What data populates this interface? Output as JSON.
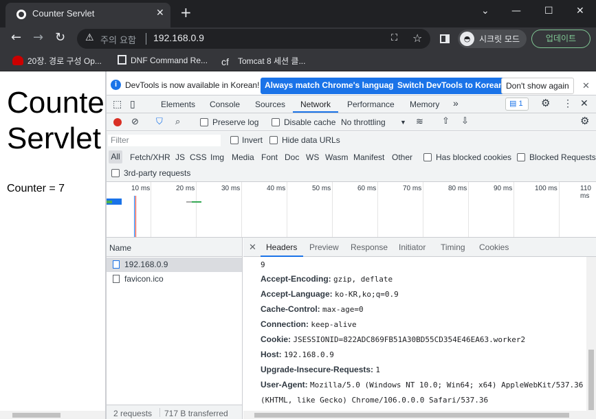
{
  "browser": {
    "tab_title": "Counter Servlet",
    "new_tab_icon": "+",
    "address": {
      "security_label": "주의 요함",
      "url": "192.168.0.9"
    },
    "incognito_label": "시크릿 모드",
    "update_label": "업데이트"
  },
  "bookmarks": [
    {
      "label": "20장. 경로 구성 Op...",
      "icon": "redhat-icon"
    },
    {
      "label": "DNF Command Re...",
      "icon": "book-icon"
    },
    {
      "label": "Tomcat 8 세션 클...",
      "icon": "cf-icon"
    }
  ],
  "page": {
    "heading": "Counter Servlet",
    "counter_text": "Counter = 7"
  },
  "devtools": {
    "infobar": {
      "message": "DevTools is now available in Korean!",
      "btn_match": "Always match Chrome's language",
      "btn_switch": "Switch DevTools to Korean",
      "btn_dismiss": "Don't show again"
    },
    "tabs": [
      "Elements",
      "Console",
      "Sources",
      "Network",
      "Performance",
      "Memory"
    ],
    "active_tab": "Network",
    "more_tabs": "»",
    "issues_count": "1",
    "network_toolbar": {
      "preserve_log": "Preserve log",
      "disable_cache": "Disable cache",
      "throttling": "No throttling"
    },
    "filter": {
      "placeholder": "Filter",
      "invert": "Invert",
      "hide_data_urls": "Hide data URLs"
    },
    "types": [
      "All",
      "Fetch/XHR",
      "JS",
      "CSS",
      "Img",
      "Media",
      "Font",
      "Doc",
      "WS",
      "Wasm",
      "Manifest",
      "Other"
    ],
    "has_blocked_cookies": "Has blocked cookies",
    "blocked_requests": "Blocked Requests",
    "third_party": "3rd-party requests",
    "timeline_ticks": [
      "10 ms",
      "20 ms",
      "30 ms",
      "40 ms",
      "50 ms",
      "60 ms",
      "70 ms",
      "80 ms",
      "90 ms",
      "100 ms",
      "110 ms"
    ],
    "request_list": {
      "header": "Name",
      "rows": [
        "192.168.0.9",
        "favicon.ico"
      ],
      "status": "2 requests",
      "transferred": "717 B transferred"
    },
    "detail": {
      "tabs": [
        "Headers",
        "Preview",
        "Response",
        "Initiator",
        "Timing",
        "Cookies"
      ],
      "active_tab": "Headers",
      "partial_top": "9",
      "headers": [
        {
          "name": "Accept-Encoding:",
          "value": "gzip, deflate"
        },
        {
          "name": "Accept-Language:",
          "value": "ko-KR,ko;q=0.9"
        },
        {
          "name": "Cache-Control:",
          "value": "max-age=0"
        },
        {
          "name": "Connection:",
          "value": "keep-alive"
        },
        {
          "name": "Cookie:",
          "value": "JSESSIONID=822ADC869FB51A30BD55CD354E46EA63.worker2"
        },
        {
          "name": "Host:",
          "value": "192.168.0.9"
        },
        {
          "name": "Upgrade-Insecure-Requests:",
          "value": "1"
        },
        {
          "name": "User-Agent:",
          "value": "Mozilla/5.0 (Windows NT 10.0; Win64; x64) AppleWebKit/537.36"
        }
      ],
      "continuation": "(KHTML, like Gecko) Chrome/106.0.0.0 Safari/537.36"
    }
  }
}
